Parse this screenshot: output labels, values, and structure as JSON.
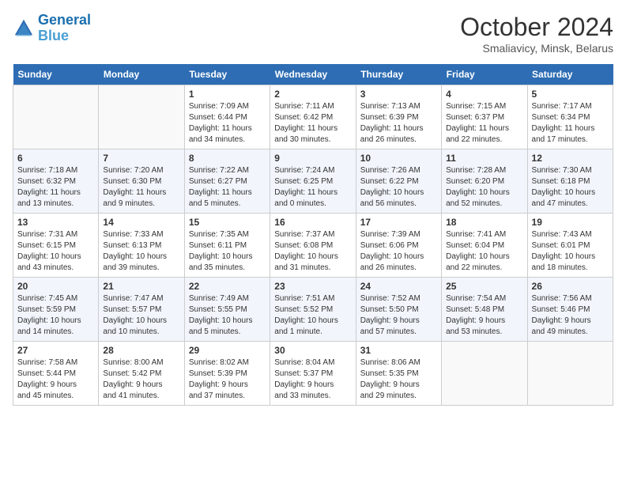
{
  "header": {
    "logo_line1": "General",
    "logo_line2": "Blue",
    "month": "October 2024",
    "location": "Smaliavicy, Minsk, Belarus"
  },
  "weekdays": [
    "Sunday",
    "Monday",
    "Tuesday",
    "Wednesday",
    "Thursday",
    "Friday",
    "Saturday"
  ],
  "weeks": [
    [
      {
        "day": "",
        "info": ""
      },
      {
        "day": "",
        "info": ""
      },
      {
        "day": "1",
        "info": "Sunrise: 7:09 AM\nSunset: 6:44 PM\nDaylight: 11 hours\nand 34 minutes."
      },
      {
        "day": "2",
        "info": "Sunrise: 7:11 AM\nSunset: 6:42 PM\nDaylight: 11 hours\nand 30 minutes."
      },
      {
        "day": "3",
        "info": "Sunrise: 7:13 AM\nSunset: 6:39 PM\nDaylight: 11 hours\nand 26 minutes."
      },
      {
        "day": "4",
        "info": "Sunrise: 7:15 AM\nSunset: 6:37 PM\nDaylight: 11 hours\nand 22 minutes."
      },
      {
        "day": "5",
        "info": "Sunrise: 7:17 AM\nSunset: 6:34 PM\nDaylight: 11 hours\nand 17 minutes."
      }
    ],
    [
      {
        "day": "6",
        "info": "Sunrise: 7:18 AM\nSunset: 6:32 PM\nDaylight: 11 hours\nand 13 minutes."
      },
      {
        "day": "7",
        "info": "Sunrise: 7:20 AM\nSunset: 6:30 PM\nDaylight: 11 hours\nand 9 minutes."
      },
      {
        "day": "8",
        "info": "Sunrise: 7:22 AM\nSunset: 6:27 PM\nDaylight: 11 hours\nand 5 minutes."
      },
      {
        "day": "9",
        "info": "Sunrise: 7:24 AM\nSunset: 6:25 PM\nDaylight: 11 hours\nand 0 minutes."
      },
      {
        "day": "10",
        "info": "Sunrise: 7:26 AM\nSunset: 6:22 PM\nDaylight: 10 hours\nand 56 minutes."
      },
      {
        "day": "11",
        "info": "Sunrise: 7:28 AM\nSunset: 6:20 PM\nDaylight: 10 hours\nand 52 minutes."
      },
      {
        "day": "12",
        "info": "Sunrise: 7:30 AM\nSunset: 6:18 PM\nDaylight: 10 hours\nand 47 minutes."
      }
    ],
    [
      {
        "day": "13",
        "info": "Sunrise: 7:31 AM\nSunset: 6:15 PM\nDaylight: 10 hours\nand 43 minutes."
      },
      {
        "day": "14",
        "info": "Sunrise: 7:33 AM\nSunset: 6:13 PM\nDaylight: 10 hours\nand 39 minutes."
      },
      {
        "day": "15",
        "info": "Sunrise: 7:35 AM\nSunset: 6:11 PM\nDaylight: 10 hours\nand 35 minutes."
      },
      {
        "day": "16",
        "info": "Sunrise: 7:37 AM\nSunset: 6:08 PM\nDaylight: 10 hours\nand 31 minutes."
      },
      {
        "day": "17",
        "info": "Sunrise: 7:39 AM\nSunset: 6:06 PM\nDaylight: 10 hours\nand 26 minutes."
      },
      {
        "day": "18",
        "info": "Sunrise: 7:41 AM\nSunset: 6:04 PM\nDaylight: 10 hours\nand 22 minutes."
      },
      {
        "day": "19",
        "info": "Sunrise: 7:43 AM\nSunset: 6:01 PM\nDaylight: 10 hours\nand 18 minutes."
      }
    ],
    [
      {
        "day": "20",
        "info": "Sunrise: 7:45 AM\nSunset: 5:59 PM\nDaylight: 10 hours\nand 14 minutes."
      },
      {
        "day": "21",
        "info": "Sunrise: 7:47 AM\nSunset: 5:57 PM\nDaylight: 10 hours\nand 10 minutes."
      },
      {
        "day": "22",
        "info": "Sunrise: 7:49 AM\nSunset: 5:55 PM\nDaylight: 10 hours\nand 5 minutes."
      },
      {
        "day": "23",
        "info": "Sunrise: 7:51 AM\nSunset: 5:52 PM\nDaylight: 10 hours\nand 1 minute."
      },
      {
        "day": "24",
        "info": "Sunrise: 7:52 AM\nSunset: 5:50 PM\nDaylight: 9 hours\nand 57 minutes."
      },
      {
        "day": "25",
        "info": "Sunrise: 7:54 AM\nSunset: 5:48 PM\nDaylight: 9 hours\nand 53 minutes."
      },
      {
        "day": "26",
        "info": "Sunrise: 7:56 AM\nSunset: 5:46 PM\nDaylight: 9 hours\nand 49 minutes."
      }
    ],
    [
      {
        "day": "27",
        "info": "Sunrise: 7:58 AM\nSunset: 5:44 PM\nDaylight: 9 hours\nand 45 minutes."
      },
      {
        "day": "28",
        "info": "Sunrise: 8:00 AM\nSunset: 5:42 PM\nDaylight: 9 hours\nand 41 minutes."
      },
      {
        "day": "29",
        "info": "Sunrise: 8:02 AM\nSunset: 5:39 PM\nDaylight: 9 hours\nand 37 minutes."
      },
      {
        "day": "30",
        "info": "Sunrise: 8:04 AM\nSunset: 5:37 PM\nDaylight: 9 hours\nand 33 minutes."
      },
      {
        "day": "31",
        "info": "Sunrise: 8:06 AM\nSunset: 5:35 PM\nDaylight: 9 hours\nand 29 minutes."
      },
      {
        "day": "",
        "info": ""
      },
      {
        "day": "",
        "info": ""
      }
    ]
  ]
}
